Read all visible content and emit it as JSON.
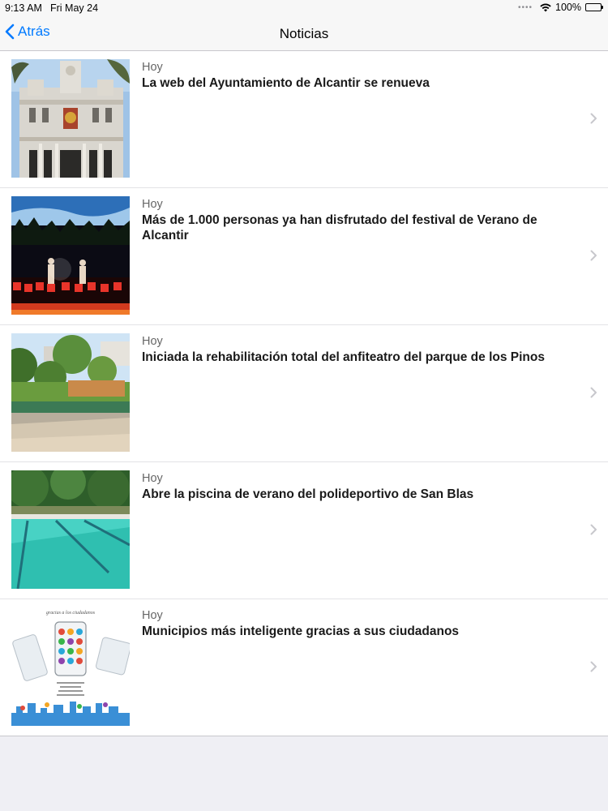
{
  "status_bar": {
    "time": "9:13 AM",
    "date": "Fri May 24",
    "battery": "100%"
  },
  "nav": {
    "back_label": "Atrás",
    "title": "Noticias"
  },
  "news": [
    {
      "date": "Hoy",
      "title": "La web del Ayuntamiento de Alcantir se renueva",
      "image": "city-hall-photo"
    },
    {
      "date": "Hoy",
      "title": "Más de 1.000 personas ya han disfrutado del festival de Verano de Alcantir",
      "image": "festival-stage-photo"
    },
    {
      "date": "Hoy",
      "title": "Iniciada la rehabilitación total del anfiteatro del parque de los Pinos",
      "image": "park-amphitheater-photo"
    },
    {
      "date": "Hoy",
      "title": "Abre la piscina de verano del polideportivo de San Blas",
      "image": "swimming-pool-photo"
    },
    {
      "date": "Hoy",
      "title": "Municipios más inteligente gracias a sus ciudadanos",
      "image": "smart-city-poster",
      "image_caption": "gracias a los ciudadanos"
    }
  ],
  "colors": {
    "accent": "#007aff",
    "background": "#efeff4"
  }
}
